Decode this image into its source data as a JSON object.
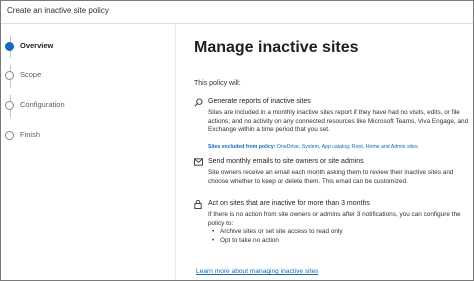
{
  "window": {
    "title": "Create an inactive site policy"
  },
  "steps": [
    {
      "label": "Overview",
      "active": true
    },
    {
      "label": "Scope",
      "active": false
    },
    {
      "label": "Configuration",
      "active": false
    },
    {
      "label": "Finish",
      "active": false
    }
  ],
  "main": {
    "heading": "Manage inactive sites",
    "intro": "This policy will:",
    "items": [
      {
        "icon": "search-icon",
        "title": "Generate reports of inactive sites",
        "body": "Sites are included in a monthly inactive sites report if they have had no visits, edits, or file actions, and no activity on any connected resources like Microsoft Teams, Viva Engage, and Exchange within a time period that you set.",
        "note_label": "Sites excluded from policy:",
        "note_value": " OneDrive, System, App catalog, Root, Home and Admin sites."
      },
      {
        "icon": "mail-icon",
        "title": "Send monthly emails to site owners or site admins",
        "body": "Site owners receive an email each month asking them to review their inactive sites and choose whether to keep or delete them. This email can be customized."
      },
      {
        "icon": "lock-icon",
        "title": "Act on sites that are inactive for more than 3 months",
        "body": "If there is no action from site owners or admins after 3 notifications, you can configure the policy to:",
        "bullets": [
          "Archive sites or set site access to read only",
          "Opt to take no action"
        ]
      }
    ],
    "learn_more": "Learn more about managing inactive sites"
  },
  "colors": {
    "accent": "#0f6cbd",
    "text": "#323130",
    "border": "#7a7a7a"
  }
}
